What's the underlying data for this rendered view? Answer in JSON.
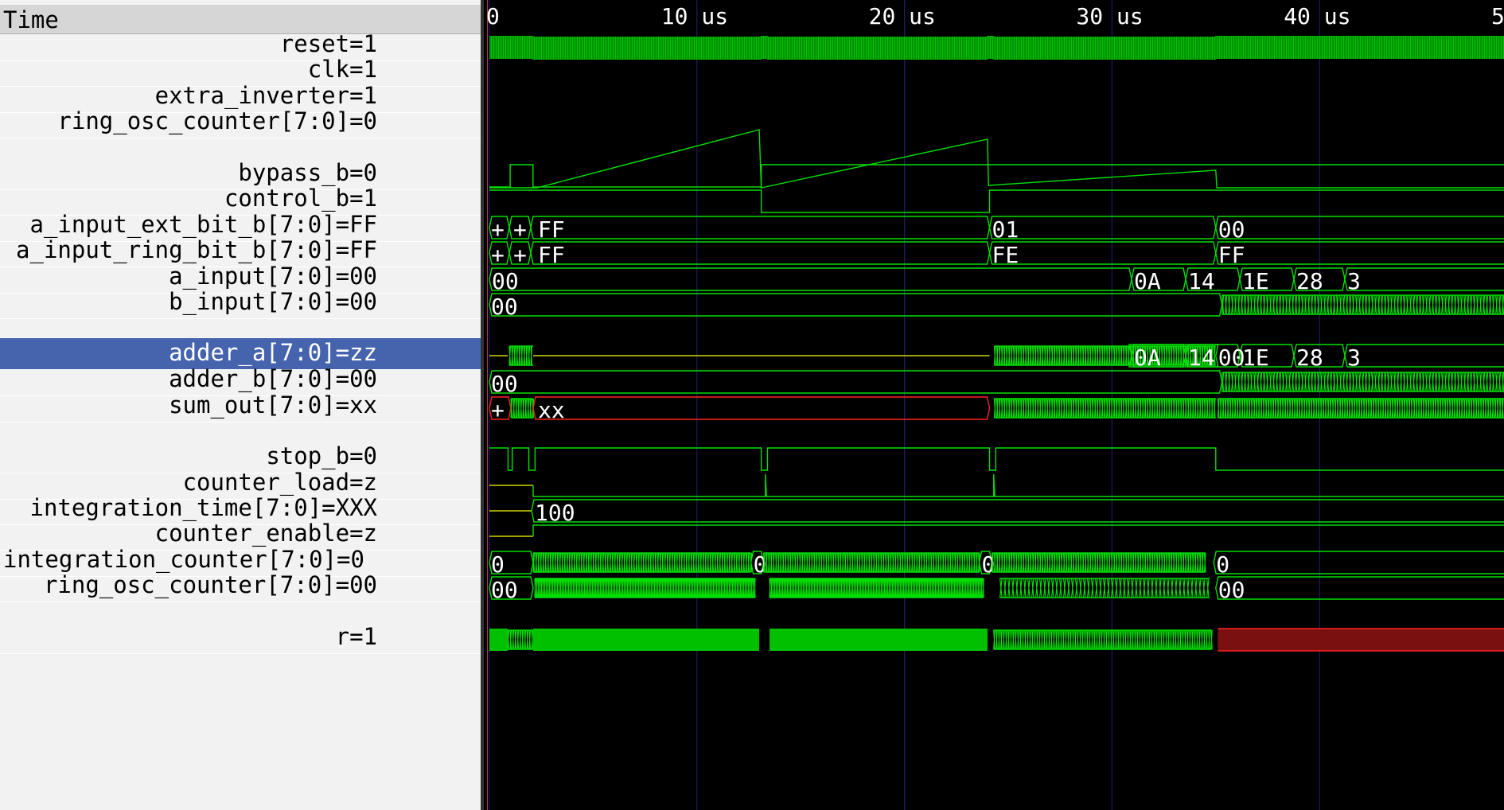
{
  "signal_panel": {
    "header": "Time",
    "rows": [
      {
        "id": "reset",
        "label": "reset=1"
      },
      {
        "id": "clk",
        "label": "clk=1"
      },
      {
        "id": "extra_inverter",
        "label": "extra_inverter=1"
      },
      {
        "id": "ring_osc_counter_analog",
        "label": "ring_osc_counter[7:0]=0"
      },
      {
        "id": "bypass_b",
        "label": "bypass_b=0"
      },
      {
        "id": "control_b",
        "label": "control_b=1"
      },
      {
        "id": "a_input_ext_bit_b",
        "label": "a_input_ext_bit_b[7:0]=FF"
      },
      {
        "id": "a_input_ring_bit_b",
        "label": "a_input_ring_bit_b[7:0]=FF"
      },
      {
        "id": "a_input",
        "label": "a_input[7:0]=00"
      },
      {
        "id": "b_input",
        "label": "b_input[7:0]=00"
      },
      {
        "id": "adder_a",
        "label": "adder_a[7:0]=zz",
        "selected": true
      },
      {
        "id": "adder_b",
        "label": "adder_b[7:0]=00"
      },
      {
        "id": "sum_out",
        "label": "sum_out[7:0]=xx"
      },
      {
        "id": "stop_b",
        "label": "stop_b=0"
      },
      {
        "id": "counter_load",
        "label": "counter_load=z"
      },
      {
        "id": "integration_time",
        "label": "integration_time[7:0]=XXX"
      },
      {
        "id": "counter_enable",
        "label": "counter_enable=z"
      },
      {
        "id": "integration_counter",
        "label": "integration_counter[7:0]=0"
      },
      {
        "id": "ring_osc_counter",
        "label": "ring_osc_counter[7:0]=00"
      },
      {
        "id": "r",
        "label": "r=1"
      }
    ]
  },
  "timeline": {
    "ticks": [
      "0",
      "10 us",
      "20 us",
      "30 us",
      "40 us",
      "5"
    ]
  },
  "bus_values": {
    "plus": "+",
    "a_input_ext_bit_b": [
      "FF",
      "01",
      "00"
    ],
    "a_input_ring_bit_b": [
      "FF",
      "FE",
      "FF"
    ],
    "a_input": [
      "00",
      "0A",
      "14",
      "1E",
      "28",
      "3"
    ],
    "b_input": [
      "00"
    ],
    "adder_a": [
      "00",
      "0A",
      "14",
      "1E",
      "28",
      "3"
    ],
    "adder_b": [
      "00"
    ],
    "sum_out": [
      "xx"
    ],
    "integration_time": [
      "100"
    ],
    "integration_counter": [
      "0",
      "0",
      "0",
      "0"
    ],
    "ring_osc_counter": [
      "00",
      "00"
    ]
  },
  "colors": {
    "wave": "#00e000",
    "fill": "#00c000",
    "undefined": "#ff2020",
    "highz": "#d4d400",
    "grid": "#1c1c6a",
    "selected": "#4564ad",
    "r_undefined": "#7a1010"
  }
}
